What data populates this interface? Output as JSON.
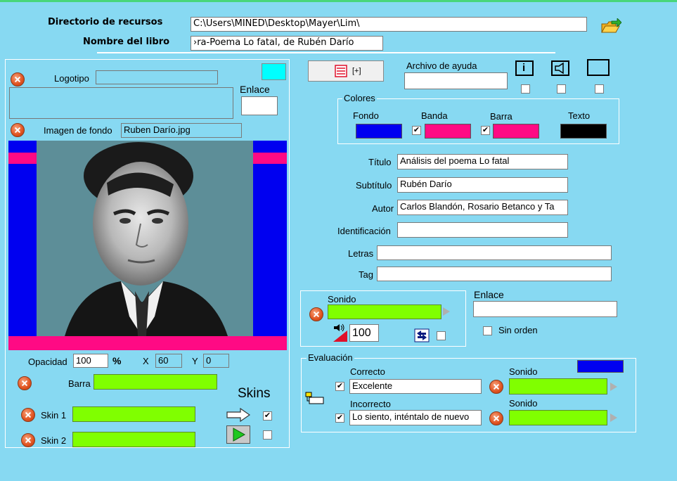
{
  "header": {
    "dir_label": "Directorio de recursos",
    "dir_value": "C:\\Users\\MINED\\Desktop\\Mayer\\Lim\\",
    "book_label": "Nombre del libro",
    "book_value": "›ra-Poema Lo fatal, de Rubén Darío"
  },
  "left": {
    "logo_label": "Logotipo",
    "logo_value": "",
    "enlace_label": "Enlace",
    "bg_label": "Imagen de fondo",
    "bg_value": "Ruben Darío.jpg",
    "opacity_label": "Opacidad",
    "opacity_value": "100",
    "percent_sign": "%",
    "x_label": "X",
    "x_value": "60",
    "y_label": "Y",
    "y_value": "0",
    "barra_label": "Barra",
    "skins_title": "Skins",
    "skin1_label": "Skin 1",
    "skin2_label": "Skin 2",
    "skin1_checked": "✔",
    "skin2_checked": ""
  },
  "right": {
    "page_button_label": "[+]",
    "help_label": "Archivo de ayuda",
    "help_value": "",
    "info_icon_text": "i",
    "colors_legend": "Colores",
    "fondo_label": "Fondo",
    "banda_label": "Banda",
    "barra_label": "Barra",
    "texto_label": "Texto",
    "banda_checked": "✔",
    "barra_checked": "✔",
    "titulo_label": "Título",
    "titulo_value": "Análisis del poema Lo fatal",
    "subtitulo_label": "Subtítulo",
    "subtitulo_value": "Rubén Darío",
    "autor_label": "Autor",
    "autor_value": "Carlos Blandón, Rosario Betanco y Ta",
    "ident_label": "Identificación",
    "ident_value": "",
    "letras_label": "Letras",
    "letras_value": "",
    "tag_label": "Tag",
    "tag_value": "",
    "sonido_label": "Sonido",
    "volume_value": "100",
    "enlace_label": "Enlace",
    "enlace_value": "",
    "sin_orden_label": "Sin orden",
    "eval_legend": "Evaluación",
    "correcto_label": "Correcto",
    "correcto_value": "Excelente",
    "incorrecto_label": "Incorrecto",
    "incorrecto_value": "Lo siento, inténtalo de nuevo",
    "sonido2_label": "Sonido",
    "sonido3_label": "Sonido",
    "correcto_checked": "✔",
    "incorrecto_checked": "✔"
  },
  "colors": {
    "background": "#87d9f2",
    "fondo": "#0000f0",
    "banda": "#ff0a84",
    "barra": "#ff0a84",
    "texto": "#000000",
    "accent_green": "#80ff00",
    "logo_swatch": "#00ffff"
  }
}
